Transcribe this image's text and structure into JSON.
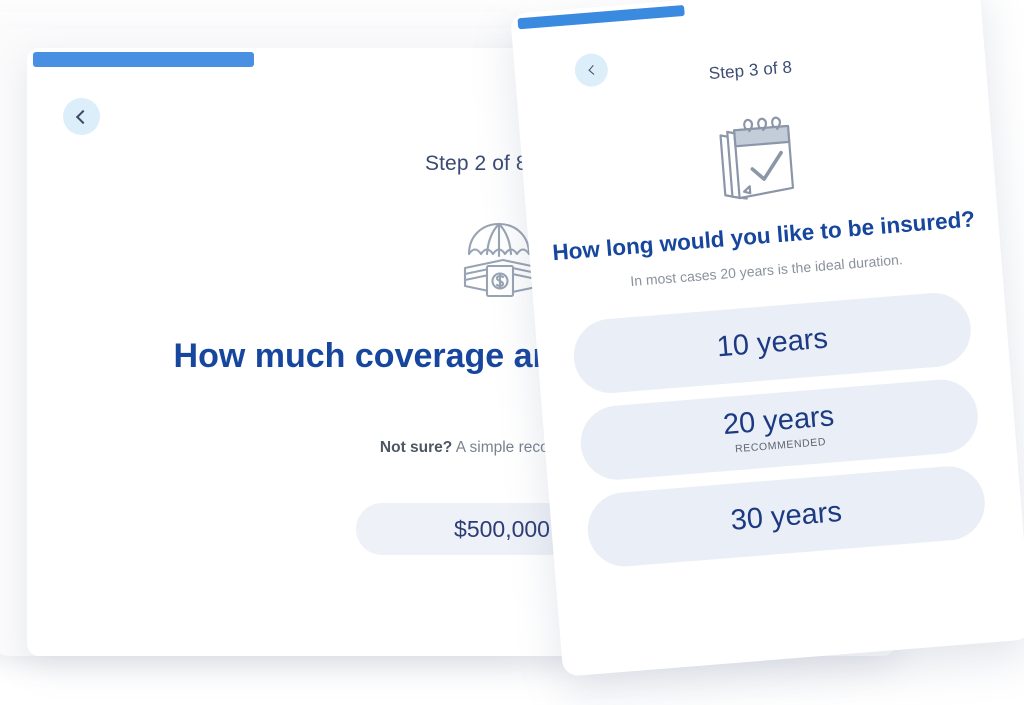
{
  "theme": {
    "accent_blue": "#4a90e2",
    "headline_blue": "#17469e",
    "option_blue": "#1b3a82",
    "pill_bg": "#eef1f7",
    "option_bg": "#eaeef6",
    "backbtn_bg": "#ddeefb",
    "muted_text": "#7a828e"
  },
  "back_card": {
    "back_button": {
      "icon": "chevron-left-icon",
      "label": "Back"
    },
    "step_label": "Step 2 of 8",
    "hero_icon": "umbrella-over-money-icon",
    "headline": "How much coverage are you looking for?",
    "subline_bold": "Not sure?",
    "subline_rest": " A simple recommendation",
    "amount_option": "$500,000"
  },
  "front_card": {
    "back_button": {
      "icon": "chevron-left-icon",
      "label": "Back"
    },
    "step_label": "Step 3 of 8",
    "hero_icon": "calendar-check-icon",
    "headline": "How long would you like to be insured?",
    "subline": "In most cases 20 years is the ideal duration.",
    "options": [
      {
        "label": "10 years",
        "recommended": ""
      },
      {
        "label": "20 years",
        "recommended": "RECOMMENDED"
      },
      {
        "label": "30 years",
        "recommended": ""
      }
    ]
  }
}
